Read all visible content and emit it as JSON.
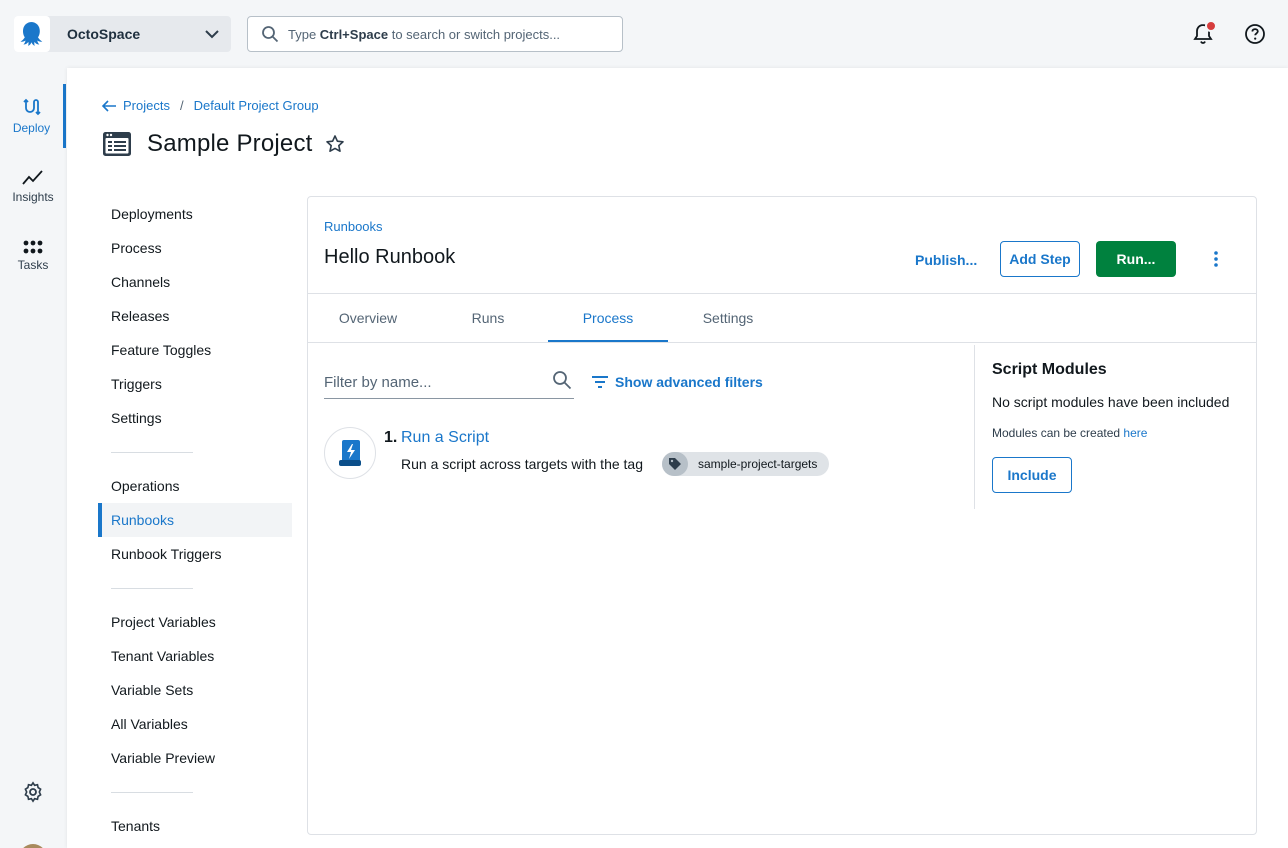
{
  "space": {
    "name": "OctoSpace"
  },
  "search": {
    "prefix": "Type ",
    "hotkey": "Ctrl+Space",
    "suffix": " to search or switch projects..."
  },
  "rail": {
    "items": [
      {
        "label": "Deploy",
        "icon": "deploy-icon",
        "active": true
      },
      {
        "label": "Insights",
        "icon": "insights-icon"
      },
      {
        "label": "Tasks",
        "icon": "tasks-icon"
      }
    ]
  },
  "breadcrumb": {
    "projects": "Projects",
    "separator": "/",
    "group": "Default Project Group"
  },
  "project": {
    "title": "Sample Project"
  },
  "project_nav": {
    "group1": [
      "Deployments",
      "Process",
      "Channels",
      "Releases",
      "Feature Toggles",
      "Triggers",
      "Settings"
    ],
    "group2": [
      "Operations",
      "Runbooks",
      "Runbook Triggers"
    ],
    "group3": [
      "Project Variables",
      "Tenant Variables",
      "Variable Sets",
      "All Variables",
      "Variable Preview"
    ],
    "group4": [
      "Tenants"
    ],
    "active": "Runbooks"
  },
  "runbook": {
    "crumb": "Runbooks",
    "title": "Hello Runbook",
    "publish_label": "Publish...",
    "add_step_label": "Add Step",
    "run_label": "Run...",
    "run_color": "#00813e"
  },
  "tabs": [
    "Overview",
    "Runs",
    "Process",
    "Settings"
  ],
  "active_tab": "Process",
  "filter": {
    "placeholder": "Filter by name...",
    "advanced_label": "Show advanced filters"
  },
  "steps": [
    {
      "number": "1.",
      "title": "Run a Script",
      "description": "Run a script across targets with the tag",
      "tag": "sample-project-targets"
    }
  ],
  "script_modules": {
    "title": "Script Modules",
    "empty": "No script modules have been included",
    "hint_prefix": "Modules can be created ",
    "hint_link": "here",
    "include_label": "Include"
  },
  "colors": {
    "accent": "#1a77ca",
    "notification": "#d63d3d"
  }
}
